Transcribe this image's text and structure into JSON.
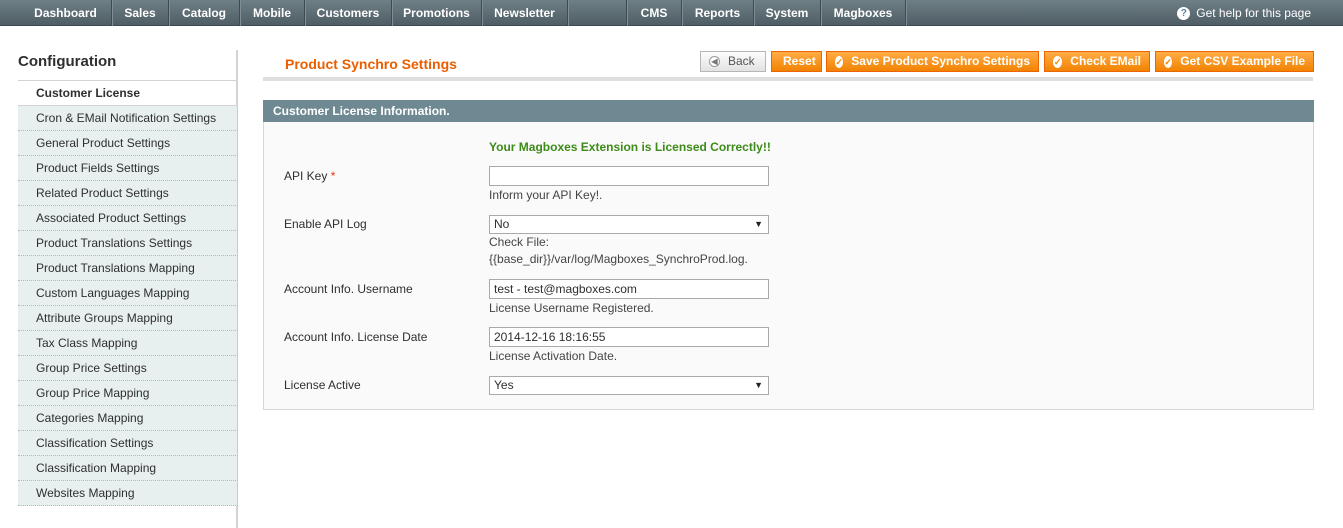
{
  "nav": {
    "items": [
      "Dashboard",
      "Sales",
      "Catalog",
      "Mobile",
      "Customers",
      "Promotions",
      "Newsletter",
      "",
      "CMS",
      "Reports",
      "System",
      "Magboxes"
    ],
    "help": "Get help for this page"
  },
  "sidebar": {
    "title": "Configuration",
    "items": [
      "Customer License",
      "Cron & EMail Notification Settings",
      "General Product Settings",
      "Product Fields Settings",
      "Related Product Settings",
      "Associated Product Settings",
      "Product Translations Settings",
      "Product Translations Mapping",
      "Custom Languages Mapping",
      "Attribute Groups Mapping",
      "Tax Class Mapping",
      "Group Price Settings",
      "Group Price Mapping",
      "Categories Mapping",
      "Classification Settings",
      "Classification Mapping",
      "Websites Mapping"
    ]
  },
  "page": {
    "title": "Product Synchro Settings",
    "buttons": {
      "back": "Back",
      "reset": "Reset",
      "save": "Save Product Synchro Settings",
      "check_email": "Check EMail",
      "csv": "Get CSV Example File"
    }
  },
  "fieldset": {
    "title": "Customer License Information.",
    "license_message": "Your Magboxes Extension is Licensed Correctly!!",
    "api_key": {
      "label": "API Key",
      "required": "*",
      "value": "",
      "note": "Inform your API Key!."
    },
    "api_log": {
      "label": "Enable API Log",
      "value": "No",
      "note1": "Check File:",
      "note2": "{{base_dir}}/var/log/Magboxes_SynchroProd.log."
    },
    "username": {
      "label": "Account Info. Username",
      "value": "test - test@magboxes.com",
      "note": "License Username Registered."
    },
    "license_date": {
      "label": "Account Info. License Date",
      "value": "2014-12-16 18:16:55",
      "note": "License Activation Date."
    },
    "license_active": {
      "label": "License Active",
      "value": "Yes"
    }
  },
  "colors": {
    "accent": "#eb5e00",
    "button": "#f28302",
    "nav": "#5e6e75",
    "fieldset_header": "#6f8992",
    "success": "#3d8b18"
  },
  "icons": {
    "help": "help-circle-icon",
    "back": "arrow-left-icon",
    "button": "check-circle-icon",
    "select": "caret-down-icon"
  }
}
